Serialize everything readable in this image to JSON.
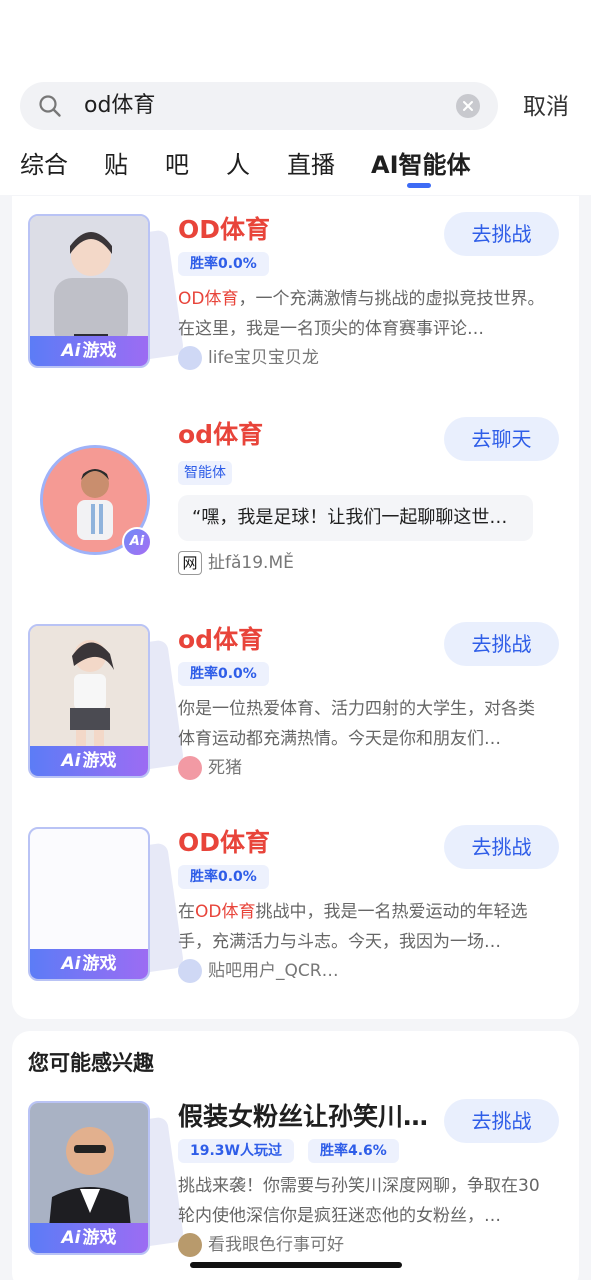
{
  "search": {
    "query": "od体育",
    "cancel_label": "取消"
  },
  "tabs": [
    {
      "label": "综合"
    },
    {
      "label": "贴"
    },
    {
      "label": "吧"
    },
    {
      "label": "人"
    },
    {
      "label": "直播"
    },
    {
      "label": "AI智能体",
      "active": true
    }
  ],
  "results": [
    {
      "title": "OD体育",
      "button": "去挑战",
      "winrate": "胜率0.0%",
      "desc_highlight": "OD体育",
      "desc_rest": "，一个充满激情与挑战的虚拟竞技世界。在这里，我是一名顶尖的体育赛事评论…",
      "badge": "游戏",
      "badge_prefix": "Ai",
      "author": "life宝贝宝贝龙"
    },
    {
      "title": "od体育",
      "button": "去聊天",
      "tag": "智能体",
      "quote": "“嘿，我是足球！让我们一起聊聊这世…",
      "author": "扯fǎ19.MĚ",
      "author_icon": "网",
      "ai_mark": "Ai"
    },
    {
      "title": "od体育",
      "button": "去挑战",
      "winrate": "胜率0.0%",
      "desc": "你是一位热爱体育、活力四射的大学生，对各类体育运动都充满热情。今天是你和朋友们…",
      "badge": "游戏",
      "badge_prefix": "Ai",
      "author": "死猪"
    },
    {
      "title": "OD体育",
      "button": "去挑战",
      "winrate": "胜率0.0%",
      "desc_pre": "在",
      "desc_highlight": "OD体育",
      "desc_rest": "挑战中，我是一名热爱运动的年轻选手，充满活力与斗志。今天，我因为一场…",
      "badge": "游戏",
      "badge_prefix": "Ai",
      "author": "贴吧用户_QCR…"
    }
  ],
  "recommend": {
    "heading": "您可能感兴趣",
    "item": {
      "title": "假装女粉丝让孙笑川…",
      "button": "去挑战",
      "plays": "19.3W人玩过",
      "winrate": "胜率4.6%",
      "desc": "挑战来袭！你需要与孙笑川深度网聊，争取在30轮内使他深信你是疯狂迷恋他的女粉丝，…",
      "badge": "游戏",
      "badge_prefix": "Ai",
      "author": "看我眼色行事可好"
    }
  },
  "colors": {
    "accent": "#2e5de8",
    "highlight": "#e8443a",
    "badge_gradient_start": "#5c7cf6",
    "badge_gradient_end": "#9c6cf3"
  }
}
